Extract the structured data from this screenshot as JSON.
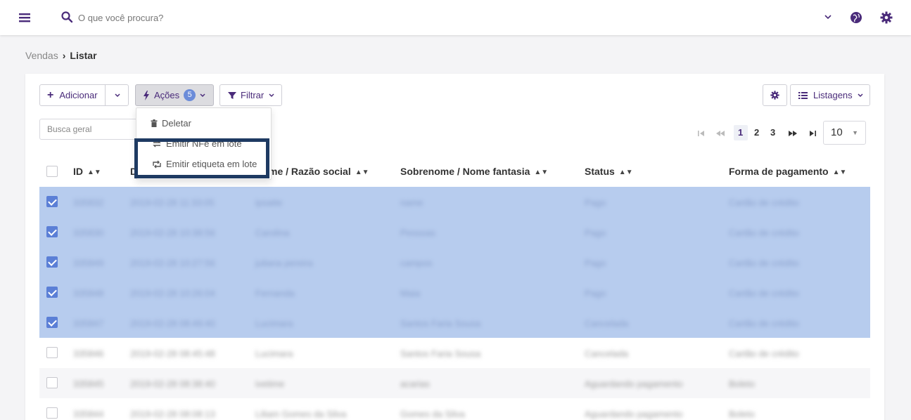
{
  "topbar": {
    "search_placeholder": "O que você procura?"
  },
  "breadcrumb": {
    "parent": "Vendas",
    "separator": "›",
    "current": "Listar"
  },
  "toolbar": {
    "add_label": "Adicionar",
    "actions_label": "Ações",
    "actions_badge": "5",
    "filter_label": "Filtrar",
    "listings_label": "Listagens"
  },
  "search": {
    "placeholder": "Busca geral"
  },
  "actions_menu": {
    "items": [
      "Deletar",
      "Emitir NFe em lote",
      "Emitir etiqueta em lote"
    ]
  },
  "pagination": {
    "pages": [
      "1",
      "2",
      "3"
    ],
    "current": "1",
    "per_page": "10"
  },
  "table": {
    "columns": [
      "ID",
      "D",
      "me / Razão social",
      "Sobrenome / Nome fantasia",
      "Status",
      "Forma de pagamento"
    ],
    "rows": [
      {
        "selected": true,
        "id": "335832",
        "date": "2019-02-28 11:33:05",
        "name": "ipsatte",
        "surname": "name",
        "status": "Pago",
        "payment": "Cartão de crédito"
      },
      {
        "selected": true,
        "id": "335830",
        "date": "2019-02-28 10:38:56",
        "name": "Carolina",
        "surname": "Pessoas",
        "status": "Pago",
        "payment": "Cartão de crédito"
      },
      {
        "selected": true,
        "id": "335849",
        "date": "2019-02-28 10:27:56",
        "name": "juliana pereira",
        "surname": "campos",
        "status": "Pago",
        "payment": "Cartão de crédito"
      },
      {
        "selected": true,
        "id": "335848",
        "date": "2019-02-28 10:26:04",
        "name": "Fernanda",
        "surname": "Maia",
        "status": "Pago",
        "payment": "Cartão de crédito"
      },
      {
        "selected": true,
        "id": "335847",
        "date": "2019-02-28 08:49:40",
        "name": "Lucimara",
        "surname": "Santos Faria Sousa",
        "status": "Cancelada",
        "payment": "Cartão de crédito"
      },
      {
        "selected": false,
        "id": "335846",
        "date": "2019-02-28 08:45:48",
        "name": "Lucimara",
        "surname": "Santos Faria Sousa",
        "status": "Cancelada",
        "payment": "Cartão de crédito"
      },
      {
        "selected": false,
        "id": "335845",
        "date": "2019-02-28 08:38:40",
        "name": "ivetime",
        "surname": "acarias",
        "status": "Aguardando pagamento",
        "payment": "Boleto"
      },
      {
        "selected": false,
        "id": "335844",
        "date": "2019-02-28 08:08:13",
        "name": "Liliam Gomes da Silva",
        "surname": "Gomes da Silva",
        "status": "Aguardando pagamento",
        "payment": "Boleto"
      }
    ]
  },
  "colors": {
    "brand": "#4a2b7a",
    "selected_row": "#b7ccee",
    "checkbox_on": "#5b7fd6",
    "highlight_border": "#1e3a62"
  }
}
